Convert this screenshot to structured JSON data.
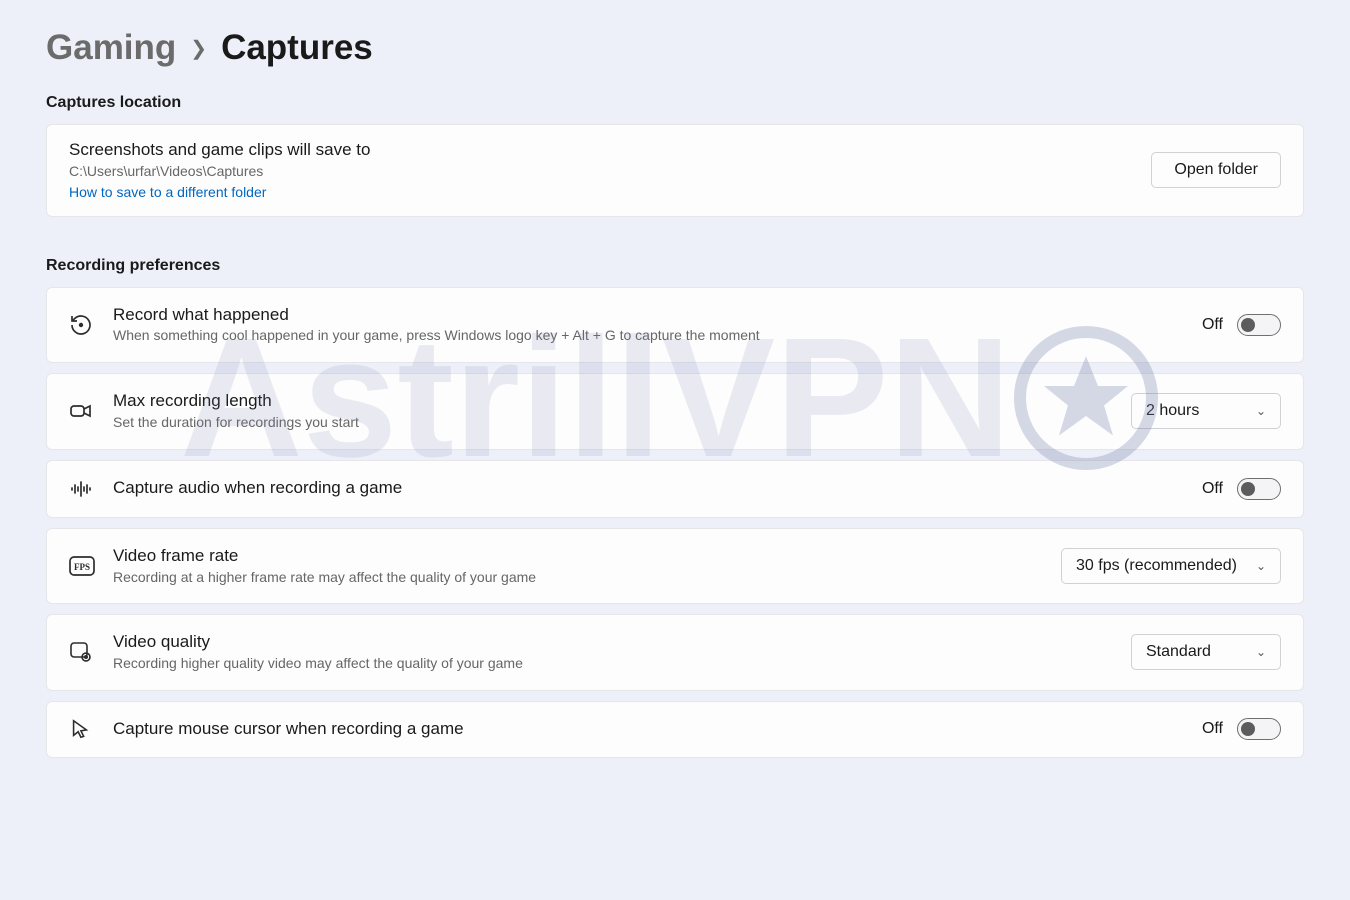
{
  "breadcrumb": {
    "parent": "Gaming",
    "current": "Captures"
  },
  "sections": {
    "location": {
      "heading": "Captures location",
      "title": "Screenshots and game clips will save to",
      "path": "C:\\Users\\urfar\\Videos\\Captures",
      "link": "How to save to a different folder",
      "button": "Open folder"
    },
    "recording": {
      "heading": "Recording preferences",
      "items": {
        "record_what_happened": {
          "title": "Record what happened",
          "sub": "When something cool happened in your game, press Windows logo key + Alt + G to capture the moment",
          "toggle_state": "Off"
        },
        "max_length": {
          "title": "Max recording length",
          "sub": "Set the duration for recordings you start",
          "value": "2 hours"
        },
        "capture_audio": {
          "title": "Capture audio when recording a game",
          "toggle_state": "Off"
        },
        "frame_rate": {
          "title": "Video frame rate",
          "sub": "Recording at a higher frame rate may affect the quality of your game",
          "value": "30 fps (recommended)"
        },
        "video_quality": {
          "title": "Video quality",
          "sub": "Recording higher quality video may affect the quality of your game",
          "value": "Standard"
        },
        "capture_cursor": {
          "title": "Capture mouse cursor when recording a game",
          "toggle_state": "Off"
        }
      }
    }
  },
  "watermark": "AstrillVPN"
}
